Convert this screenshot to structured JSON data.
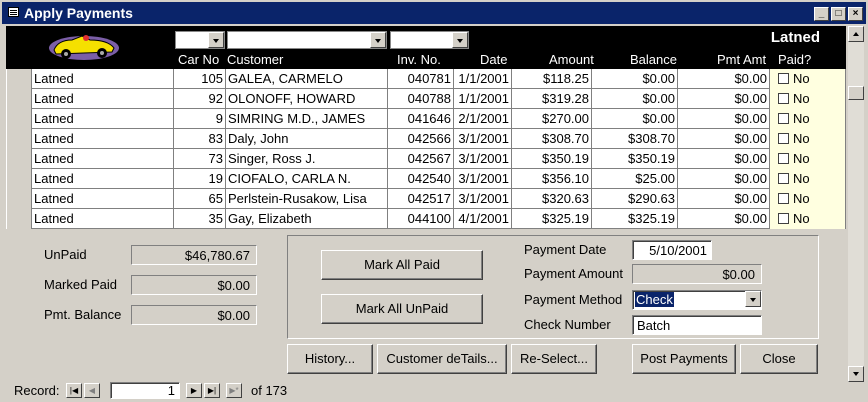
{
  "window": {
    "title": "Apply Payments"
  },
  "header": {
    "title": "Latned",
    "columns": {
      "car_no": "Car No",
      "customer": "Customer",
      "inv_no": "Inv. No.",
      "date": "Date",
      "amount": "Amount",
      "balance": "Balance",
      "pmt_amt": "Pmt Amt",
      "paid": "Paid?"
    }
  },
  "rows": [
    {
      "name": "Latned",
      "car_no": "105",
      "customer": "GALEA, CARMELO",
      "inv_no": "040781",
      "date": "1/1/2001",
      "amount": "$118.25",
      "balance": "$0.00",
      "pmt_amt": "$0.00",
      "paid": "No"
    },
    {
      "name": "Latned",
      "car_no": "92",
      "customer": "OLONOFF, HOWARD",
      "inv_no": "040788",
      "date": "1/1/2001",
      "amount": "$319.28",
      "balance": "$0.00",
      "pmt_amt": "$0.00",
      "paid": "No"
    },
    {
      "name": "Latned",
      "car_no": "9",
      "customer": "SIMRING M.D., JAMES",
      "inv_no": "041646",
      "date": "2/1/2001",
      "amount": "$270.00",
      "balance": "$0.00",
      "pmt_amt": "$0.00",
      "paid": "No"
    },
    {
      "name": "Latned",
      "car_no": "83",
      "customer": "Daly, John",
      "inv_no": "042566",
      "date": "3/1/2001",
      "amount": "$308.70",
      "balance": "$308.70",
      "pmt_amt": "$0.00",
      "paid": "No"
    },
    {
      "name": "Latned",
      "car_no": "73",
      "customer": "Singer, Ross J.",
      "inv_no": "042567",
      "date": "3/1/2001",
      "amount": "$350.19",
      "balance": "$350.19",
      "pmt_amt": "$0.00",
      "paid": "No"
    },
    {
      "name": "Latned",
      "car_no": "19",
      "customer": "CIOFALO, CARLA N.",
      "inv_no": "042540",
      "date": "3/1/2001",
      "amount": "$356.10",
      "balance": "$25.00",
      "pmt_amt": "$0.00",
      "paid": "No"
    },
    {
      "name": "Latned",
      "car_no": "65",
      "customer": "Perlstein-Rusakow, Lisa",
      "inv_no": "042517",
      "date": "3/1/2001",
      "amount": "$320.63",
      "balance": "$290.63",
      "pmt_amt": "$0.00",
      "paid": "No"
    },
    {
      "name": "Latned",
      "car_no": "35",
      "customer": "Gay, Elizabeth",
      "inv_no": "044100",
      "date": "4/1/2001",
      "amount": "$325.19",
      "balance": "$325.19",
      "pmt_amt": "$0.00",
      "paid": "No"
    }
  ],
  "summary": {
    "unpaid_label": "UnPaid",
    "unpaid_value": "$46,780.67",
    "marked_paid_label": "Marked Paid",
    "marked_paid_value": "$0.00",
    "pmt_balance_label": "Pmt. Balance",
    "pmt_balance_value": "$0.00"
  },
  "payment": {
    "mark_all_paid": "Mark All Paid",
    "mark_all_unpaid": "Mark All UnPaid",
    "date_label": "Payment Date",
    "date_value": "5/10/2001",
    "amount_label": "Payment Amount",
    "amount_value": "$0.00",
    "method_label": "Payment Method",
    "method_value": "Check",
    "check_label": "Check Number",
    "check_value": "Batch"
  },
  "buttons": {
    "history": "History...",
    "customer_details": "Customer deTails...",
    "reselect": "Re-Select...",
    "post_payments": "Post Payments",
    "close": "Close"
  },
  "navigator": {
    "record_label": "Record:",
    "current": "1",
    "of_label": "of 173"
  }
}
